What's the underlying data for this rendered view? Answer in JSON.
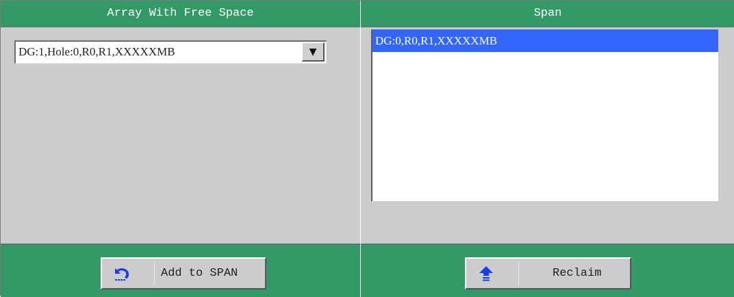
{
  "left_panel": {
    "header_title": "Array With Free Space",
    "dropdown": {
      "selected_value": "DG:1,Hole:0,R0,R1,XXXXXMB",
      "arrow": "▼"
    },
    "add_button": {
      "label": "Add to SPAN",
      "icon": "undo-arrow-icon"
    }
  },
  "right_panel": {
    "header_title": "Span",
    "list": {
      "items": [
        {
          "label": "DG:0,R0,R1,XXXXXMB",
          "selected": true
        }
      ]
    },
    "reclaim_button": {
      "label": "Reclaim",
      "icon": "up-arrow-icon"
    }
  },
  "colors": {
    "header_bg": "#339966",
    "panel_bg": "#cccccc",
    "selection_bg": "#3366ff",
    "icon_blue": "#1a3cf0"
  }
}
